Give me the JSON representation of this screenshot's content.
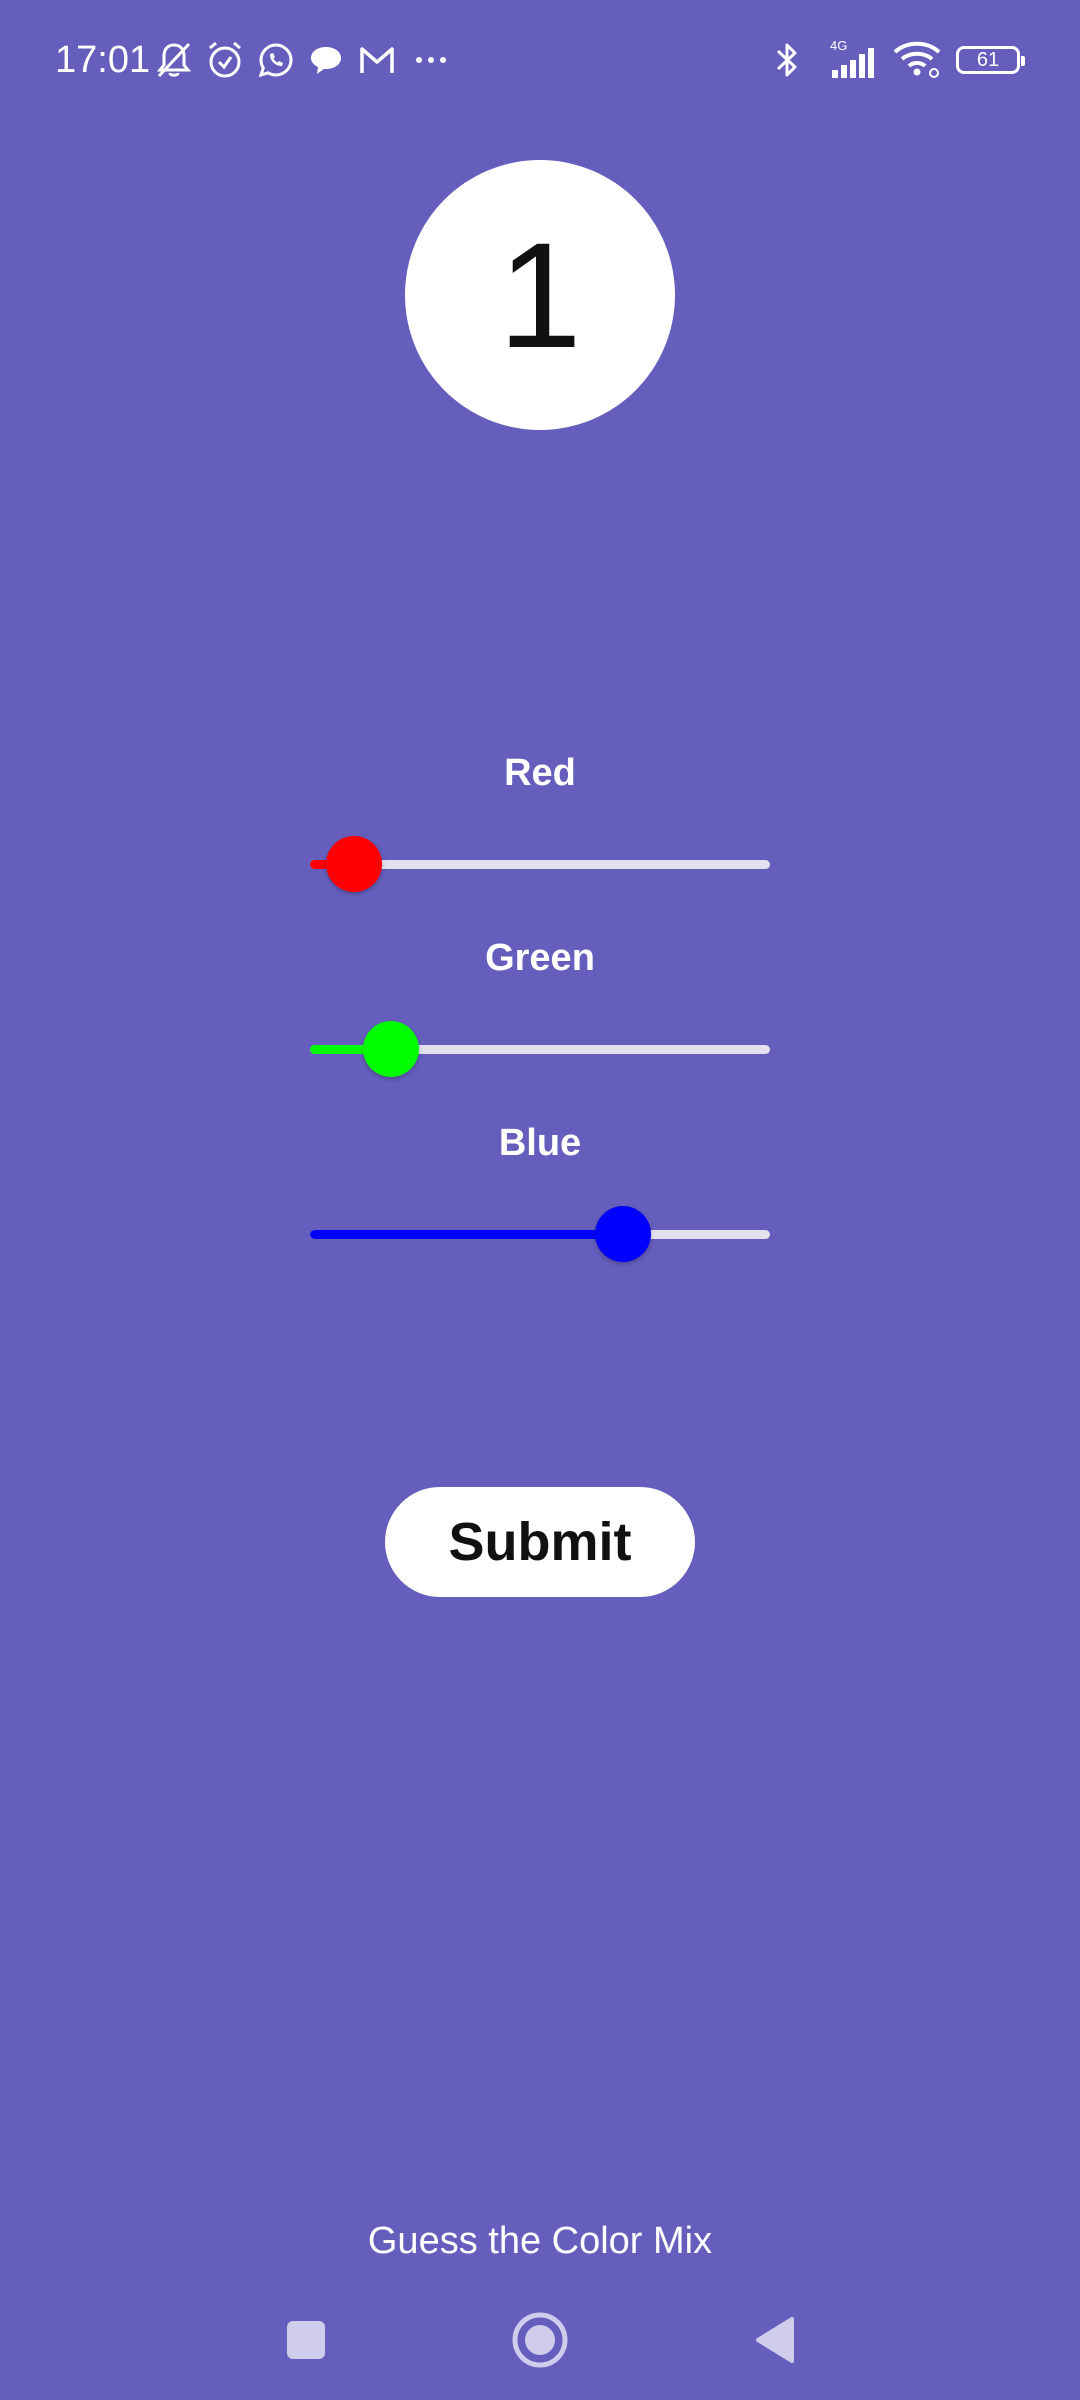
{
  "status_bar": {
    "time": "17:01",
    "network": "4G",
    "battery": "61",
    "left_icons": [
      "bell-off-icon",
      "alarm-icon",
      "whatsapp-icon",
      "chat-icon",
      "gmail-icon",
      "more-dots-icon"
    ],
    "right_icons": [
      "bluetooth-icon",
      "cellular-signal-icon",
      "wifi-icon",
      "battery-icon"
    ]
  },
  "round": {
    "number": "1"
  },
  "sliders": [
    {
      "label": "Red",
      "color": "#FF0000",
      "value_fraction": 0.095
    },
    {
      "label": "Green",
      "color": "#00FF00",
      "value_fraction": 0.175
    },
    {
      "label": "Blue",
      "color": "#0000FF",
      "value_fraction": 0.68
    }
  ],
  "submit": {
    "label": "Submit"
  },
  "footer": {
    "title": "Guess the Color Mix"
  },
  "nav": {
    "icons": [
      "recents-square-icon",
      "home-circle-icon",
      "back-triangle-icon"
    ]
  },
  "colors": {
    "background": "#655EBC",
    "track": "#E3E1EE",
    "button_bg": "#FFFFFF"
  }
}
